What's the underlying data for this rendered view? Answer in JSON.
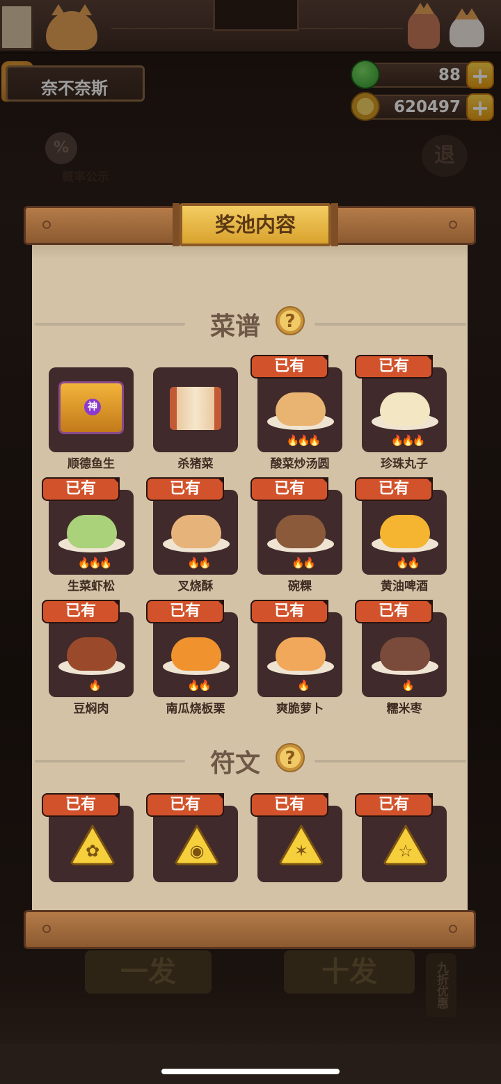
{
  "player": {
    "name": "奈不奈斯"
  },
  "currencies": {
    "jade": "88",
    "coins": "620497",
    "plus": "+"
  },
  "sidebar": {
    "prob_icon": "%",
    "prob_label": "概率公示",
    "exit_label": "退"
  },
  "bottom_buttons": {
    "single": "一发",
    "ten": "十发",
    "discount": "九折优惠"
  },
  "modal": {
    "title": "奖池内容",
    "recipe_section": "菜谱",
    "rune_section": "符文",
    "help_icon": "?",
    "owned_label": "已有",
    "shen_badge": "神",
    "recipes": [
      {
        "name": "顺德鱼生",
        "owned": false,
        "kind": "chest",
        "flames": 0
      },
      {
        "name": "杀猪菜",
        "owned": false,
        "kind": "scroll",
        "flames": 0
      },
      {
        "name": "酸菜炒汤圆",
        "owned": true,
        "kind": "dish",
        "color": "#e9b472",
        "flames": 3
      },
      {
        "name": "珍珠丸子",
        "owned": true,
        "kind": "dish",
        "color": "#f3e6c2",
        "flames": 3
      },
      {
        "name": "生菜虾松",
        "owned": true,
        "kind": "dish",
        "color": "#a9d27a",
        "flames": 3
      },
      {
        "name": "叉烧酥",
        "owned": true,
        "kind": "dish",
        "color": "#e6b37a",
        "flames": 2
      },
      {
        "name": "碗粿",
        "owned": true,
        "kind": "dish",
        "color": "#8a5a3a",
        "flames": 2
      },
      {
        "name": "黄油啤酒",
        "owned": true,
        "kind": "dish",
        "color": "#f5b531",
        "flames": 2
      },
      {
        "name": "豆焖肉",
        "owned": true,
        "kind": "dish",
        "color": "#9a4a2a",
        "flames": 1
      },
      {
        "name": "南瓜烧板栗",
        "owned": true,
        "kind": "dish",
        "color": "#f0922e",
        "flames": 2
      },
      {
        "name": "爽脆萝卜",
        "owned": true,
        "kind": "dish",
        "color": "#f2a85a",
        "flames": 1
      },
      {
        "name": "糯米枣",
        "owned": true,
        "kind": "dish",
        "color": "#7a4a3a",
        "flames": 1
      }
    ],
    "runes": [
      {
        "icon": "rune-plant-icon",
        "owned": true
      },
      {
        "icon": "rune-fish-icon",
        "owned": true
      },
      {
        "icon": "rune-crab-icon",
        "owned": true
      },
      {
        "icon": "rune-star-icon",
        "owned": true
      }
    ]
  },
  "colors": {
    "badge": "#d2532b",
    "tile": "#402a2b",
    "parchment": "#d3c2a6",
    "gold": "#f3cd62"
  }
}
